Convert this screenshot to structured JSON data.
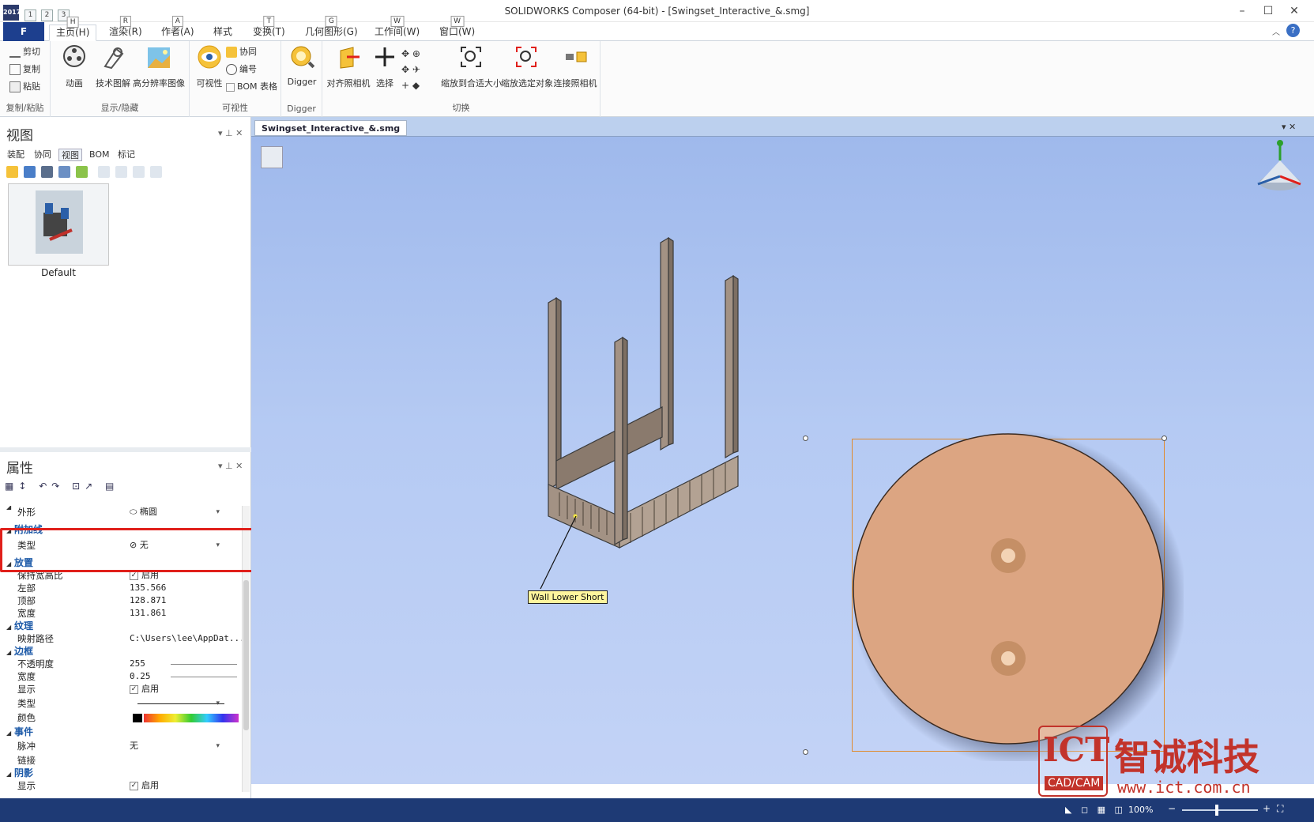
{
  "window": {
    "title": "SOLIDWORKS Composer (64-bit) - [Swingset_Interactive_&.smg]",
    "logo_text": "2017",
    "quick_access": [
      "1",
      "2",
      "3"
    ],
    "controls": {
      "minimize": "–",
      "maximize": "☐",
      "close": "✕"
    }
  },
  "ribbon": {
    "file_tab": "F",
    "tabs": [
      {
        "label": "主页(H)",
        "key": "H"
      },
      {
        "label": "渲染(R)",
        "key": "R"
      },
      {
        "label": "作者(A)",
        "key": "A"
      },
      {
        "label": "样式",
        "key": ""
      },
      {
        "label": "变换(T)",
        "key": "T"
      },
      {
        "label": "几何图形(G)",
        "key": "G"
      },
      {
        "label": "工作间(W)",
        "key": "W"
      },
      {
        "label": "窗口(W)",
        "key": "W"
      }
    ],
    "clipboard": {
      "cut": "剪切",
      "copy": "复制",
      "paste": "粘贴",
      "label": "复制/粘贴"
    },
    "showhide": {
      "animation": "动画",
      "tech_illustration": "技术图解",
      "hires_image": "高分辨率图像",
      "label": "显示/隐藏"
    },
    "visibility": {
      "visibility": "可视性",
      "collaboration": "协同",
      "numbering": "编号",
      "bom_table": "BOM 表格",
      "label": "可视性"
    },
    "digger": {
      "digger": "Digger",
      "label": "Digger"
    },
    "switch": {
      "align_camera": "对齐照相机",
      "select": "选择",
      "zoom_fit": "缩放到合适大小",
      "zoom_selected": "缩放选定对象",
      "link_camera": "连接照相机",
      "label": "切换"
    }
  },
  "views_panel": {
    "title": "视图",
    "tabs": [
      "装配",
      "协同",
      "视图",
      "BOM",
      "标记"
    ],
    "active_tab": "视图",
    "thumbnail_label": "Default"
  },
  "props_panel": {
    "title": "属性",
    "shape_label": "外形",
    "shape_value": "椭圆",
    "sections": {
      "leader": "附加线",
      "position": "放置",
      "texture": "纹理",
      "border": "边框",
      "event": "事件",
      "shadow": "阴影"
    },
    "leader_type_label": "类型",
    "leader_type_value": "无",
    "keep_ratio_label": "保持宽高比",
    "keep_ratio_value": "启用",
    "left_label": "左部",
    "left_value": "135.566",
    "top_label": "顶部",
    "top_value": "128.871",
    "width_label": "宽度",
    "width_value": "131.861",
    "map_path_label": "映射路径",
    "map_path_value": "C:\\Users\\lee\\AppDat...",
    "opacity_label": "不透明度",
    "opacity_value": "255",
    "border_width_label": "宽度",
    "border_width_value": "0.25",
    "display_label": "显示",
    "display_value": "启用",
    "border_type_label": "类型",
    "color_label": "颜色",
    "pulse_label": "脉冲",
    "pulse_value": "无",
    "link_label": "链接",
    "shadow_display_label": "显示",
    "shadow_display_value": "启用"
  },
  "document": {
    "tab": "Swingset_Interactive_&.smg",
    "annotation": "Wall Lower Short"
  },
  "status": {
    "zoom": "100%"
  },
  "watermark": {
    "brand": "ICT",
    "sub": "CAD/CAM",
    "name": "智诚科技",
    "url": "www.ict.com.cn"
  }
}
